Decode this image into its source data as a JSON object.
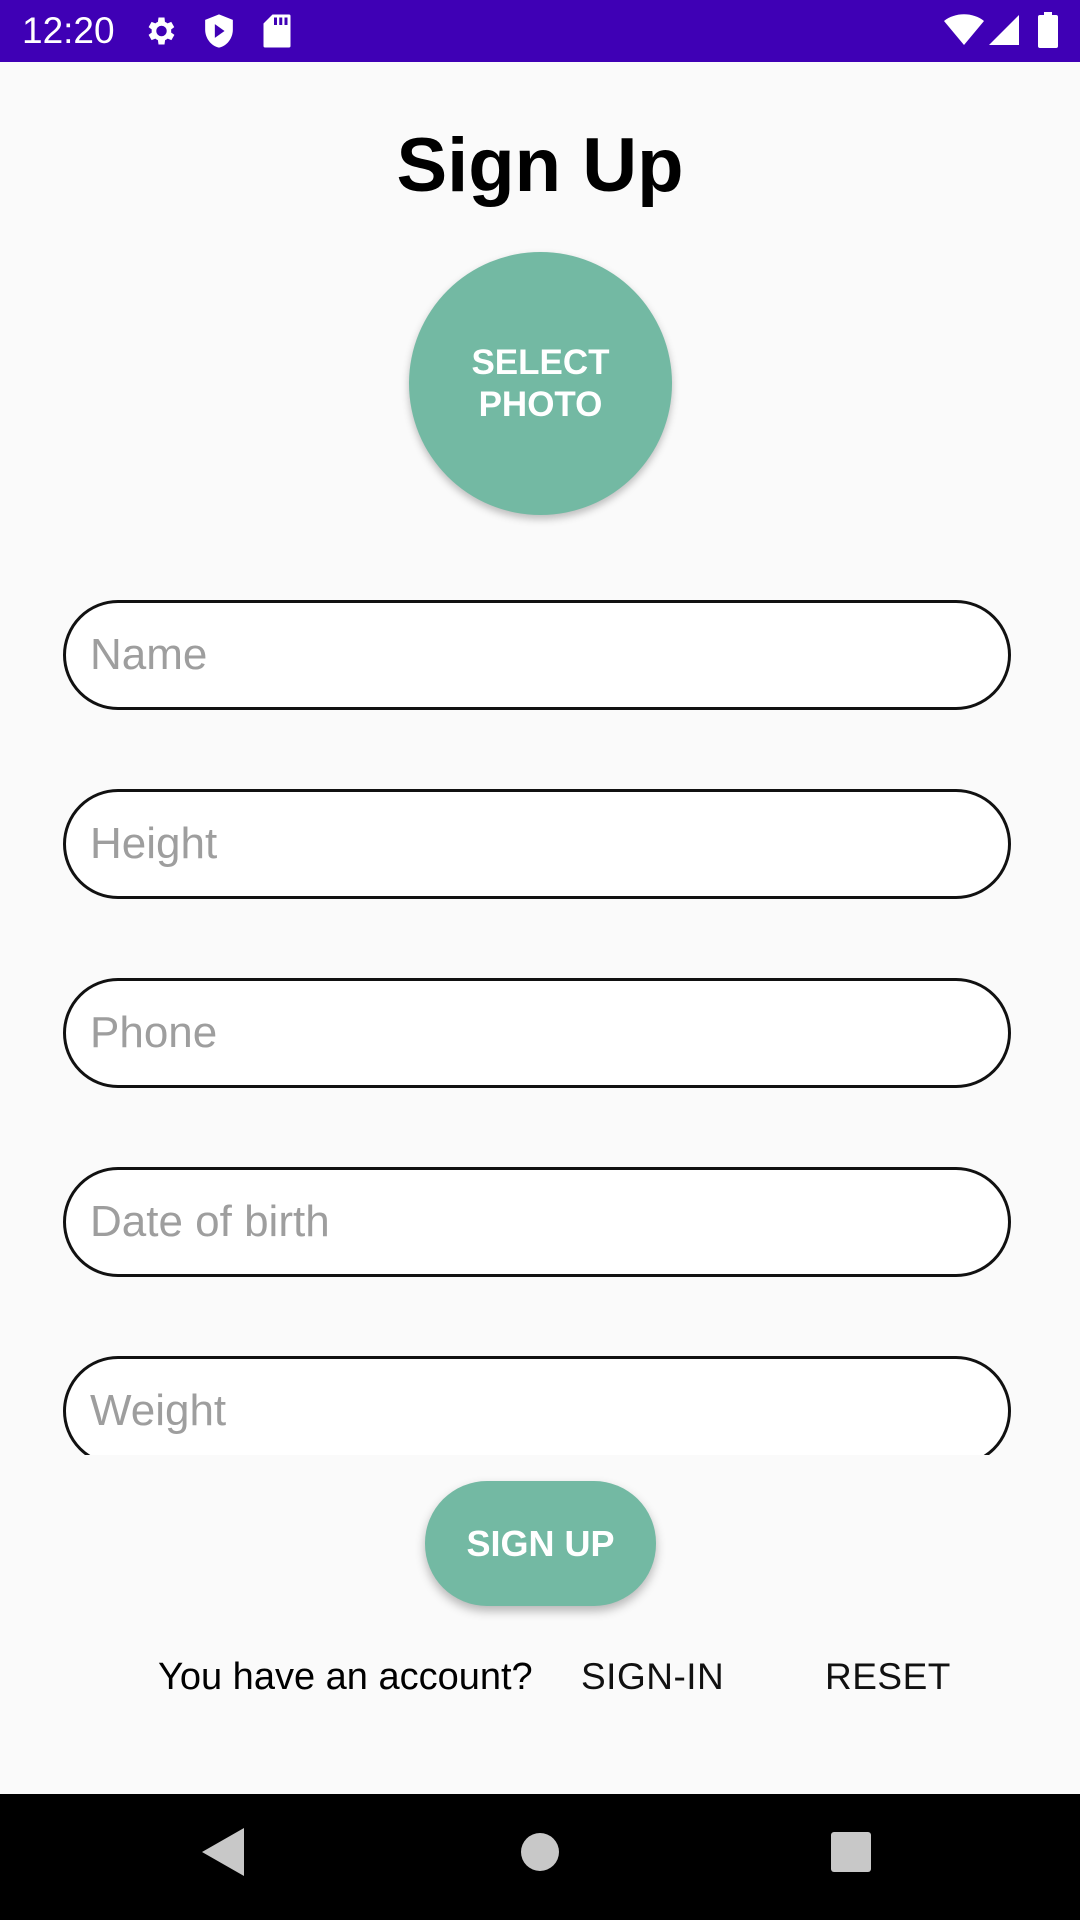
{
  "status_bar": {
    "time": "12:20",
    "background": "#3f00b5",
    "left_icons": [
      "gear-icon",
      "shield-icon",
      "sd-card-icon"
    ],
    "right_icons": [
      "wifi-icon",
      "cell-signal-icon",
      "battery-icon"
    ]
  },
  "title": "Sign Up",
  "photo_button": {
    "label": "SELECT PHOTO",
    "color": "#73b9a3"
  },
  "fields": [
    {
      "name": "name",
      "placeholder": "Name",
      "value": ""
    },
    {
      "name": "height",
      "placeholder": "Height",
      "value": ""
    },
    {
      "name": "phone",
      "placeholder": "Phone",
      "value": ""
    },
    {
      "name": "date-of-birth",
      "placeholder": "Date of birth",
      "value": ""
    },
    {
      "name": "weight",
      "placeholder": "Weight",
      "value": ""
    }
  ],
  "signup_button": {
    "label": "SIGN UP",
    "color": "#73b9a3"
  },
  "footer": {
    "account_text": "You have an account?",
    "signin_label": "SIGN-IN",
    "reset_label": "RESET"
  },
  "nav_bar": {
    "buttons": [
      "back-icon",
      "home-icon",
      "recents-icon"
    ]
  }
}
